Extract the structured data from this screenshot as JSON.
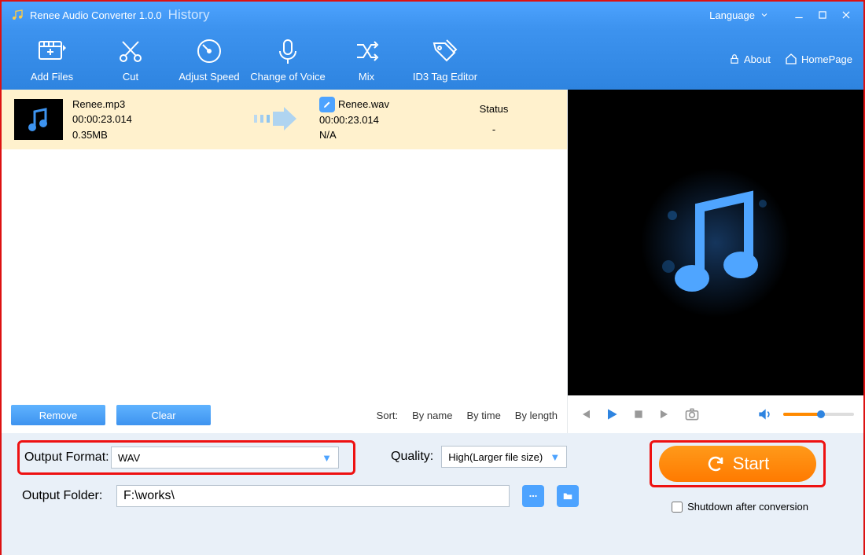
{
  "title": "Renee Audio Converter 1.0.0",
  "history": "History",
  "language_label": "Language",
  "toolbar": [
    "Add Files",
    "Cut",
    "Adjust Speed",
    "Change of Voice",
    "Mix",
    "ID3 Tag Editor"
  ],
  "links": {
    "about": "About",
    "homepage": "HomePage"
  },
  "file": {
    "in_name": "Renee.mp3",
    "in_dur": "00:00:23.014",
    "in_size": "0.35MB",
    "out_name": "Renee.wav",
    "out_dur": "00:00:23.014",
    "out_size": "N/A",
    "status_label": "Status",
    "status_val": "-"
  },
  "btn": {
    "remove": "Remove",
    "clear": "Clear"
  },
  "sort": {
    "label": "Sort:",
    "byname": "By name",
    "bytime": "By time",
    "bylength": "By length"
  },
  "output": {
    "format_label": "Output Format:",
    "format_value": "WAV",
    "quality_label": "Quality:",
    "quality_value": "High(Larger file size)",
    "folder_label": "Output Folder:",
    "folder_value": "F:\\works\\"
  },
  "start": "Start",
  "shutdown": "Shutdown after conversion"
}
